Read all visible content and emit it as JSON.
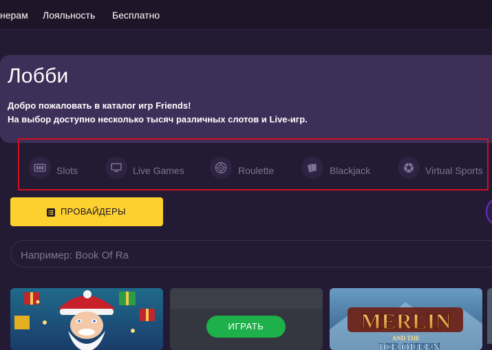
{
  "nav": {
    "items": [
      {
        "label": "нерам"
      },
      {
        "label": "Лояльность"
      },
      {
        "label": "Бесплатно"
      }
    ]
  },
  "hero": {
    "title": "Лобби",
    "line1": "Добро пожаловать в каталог игр Friends!",
    "line2": "На выбор доступно несколько тысяч различных слотов и Live-игр."
  },
  "categories": [
    {
      "label": "Slots",
      "icon": "slot-machine-icon"
    },
    {
      "label": "Live Games",
      "icon": "monitor-icon"
    },
    {
      "label": "Roulette",
      "icon": "roulette-icon"
    },
    {
      "label": "Blackjack",
      "icon": "cards-icon"
    },
    {
      "label": "Virtual Sports",
      "icon": "soccer-ball-icon"
    }
  ],
  "providers": {
    "label": "ПРОВАЙДЕРЫ",
    "icon": "list-icon"
  },
  "search": {
    "placeholder": "Например: Book Of Ra"
  },
  "games": {
    "play_label": "ИГРАТЬ",
    "merlin_title": "MERLIN",
    "merlin_sub1": "AND THE",
    "merlin_sub2": "ICE QUEEN"
  },
  "colors": {
    "background": "#231a33",
    "hero": "#3e2f58",
    "accent_yellow": "#fcd02e",
    "play_green": "#1eb04a",
    "highlight_red": "#d1101e"
  }
}
